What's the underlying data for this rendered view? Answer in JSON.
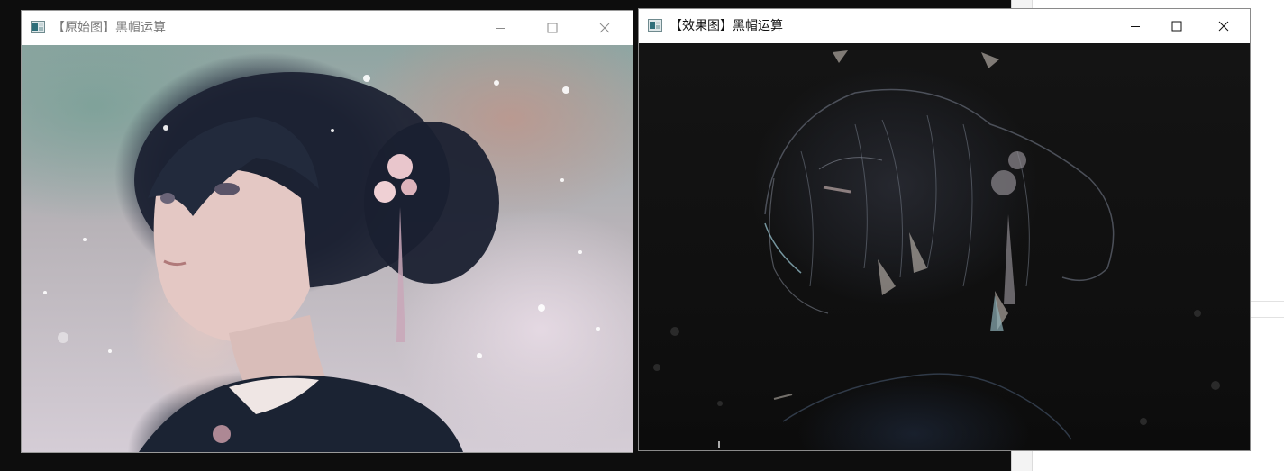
{
  "background_window": {
    "accent": "#f3f3f3"
  },
  "windows": [
    {
      "id": "original",
      "title": "【原始图】黑帽运算",
      "icon": "opencv-window-icon",
      "controls": [
        "minimize-icon",
        "maximize-icon",
        "close-icon"
      ],
      "image": "anime girl portrait with flower hairpin"
    },
    {
      "id": "result",
      "title": "【效果图】黑帽运算",
      "icon": "opencv-window-icon",
      "controls": [
        "minimize-icon",
        "maximize-icon",
        "close-icon"
      ],
      "image": "black-hat morphology result, dark image with bright edges"
    }
  ]
}
